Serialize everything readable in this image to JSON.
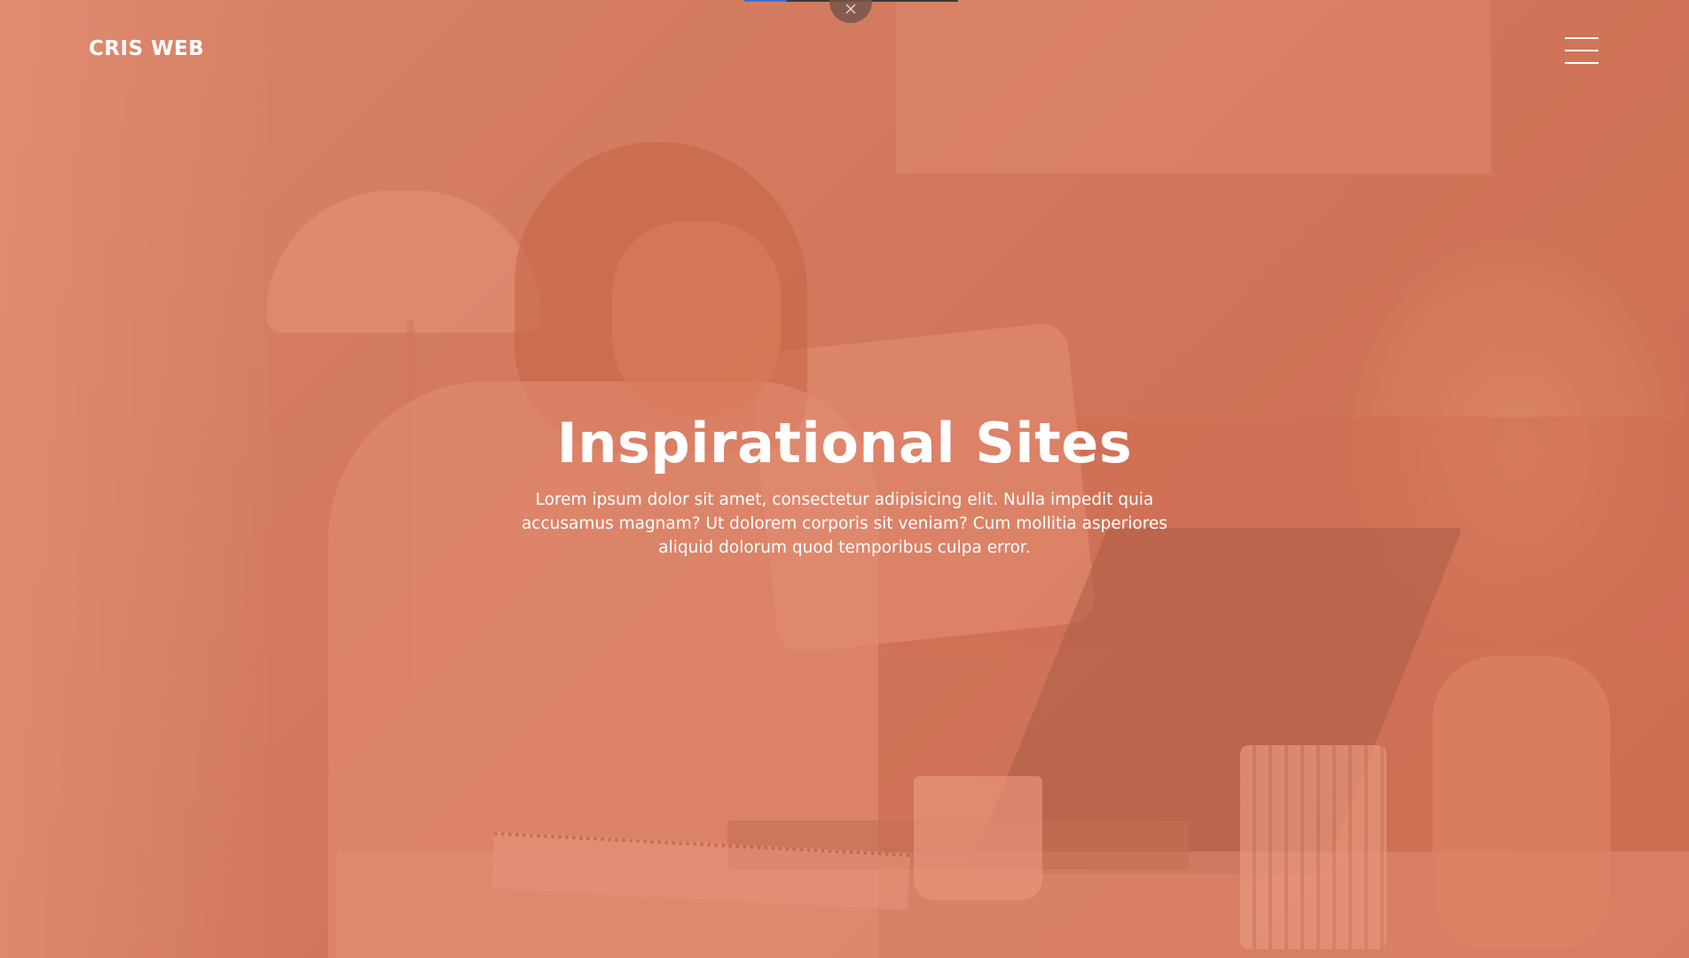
{
  "app": {
    "logo": "CRIS WEB"
  },
  "overlay_controls": {
    "close_icon": "close-icon",
    "progress": 0.2
  },
  "header": {
    "menu_icon": "hamburger-menu-icon"
  },
  "hero": {
    "title": "Inspirational Sites",
    "description": "Lorem ipsum dolor sit amet, consectetur adipisicing elit. Nulla impedit quia accusamus magnam? Ut dolorem corporis sit veniam? Cum mollitia asperiores aliquid dolorum quod temporibus culpa error."
  },
  "colors": {
    "overlay_tint": "#d07a60",
    "text": "#ffffff",
    "progress_fill": "#3e6fd8"
  }
}
